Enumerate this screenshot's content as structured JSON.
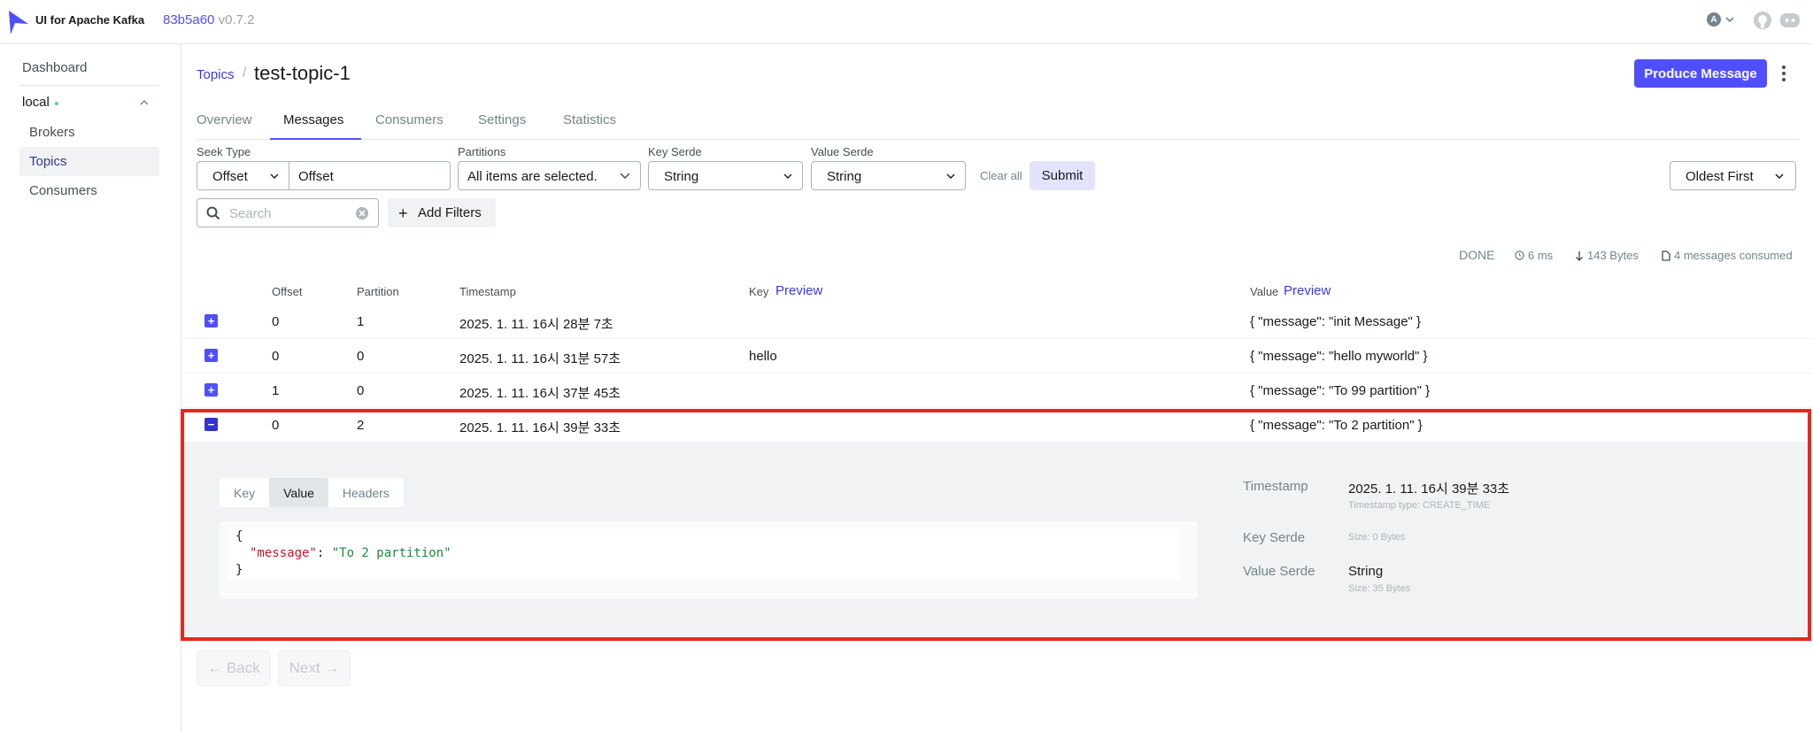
{
  "app": {
    "title": "UI for Apache Kafka",
    "version_hash": "83b5a60",
    "version": "v0.7.2",
    "user_initial": "A"
  },
  "sidebar": {
    "dashboard": "Dashboard",
    "cluster": "local",
    "items": [
      "Brokers",
      "Topics",
      "Consumers"
    ]
  },
  "breadcrumb": {
    "parent": "Topics",
    "sep": "/"
  },
  "topic_name": "test-topic-1",
  "produce_label": "Produce Message",
  "tabs": [
    "Overview",
    "Messages",
    "Consumers",
    "Settings",
    "Statistics"
  ],
  "filters": {
    "seek_type_label": "Seek Type",
    "seek_type": "Offset",
    "offset_placeholder": "Offset",
    "partitions_label": "Partitions",
    "partitions": "All items are selected.",
    "key_serde_label": "Key Serde",
    "key_serde": "String",
    "value_serde_label": "Value Serde",
    "value_serde": "String",
    "clear_all": "Clear all",
    "submit": "Submit",
    "sort": "Oldest First",
    "search_placeholder": "Search",
    "add_filters": "Add Filters"
  },
  "status": {
    "state": "DONE",
    "elapsed": "6 ms",
    "bytes": "143 Bytes",
    "consumed": "4 messages consumed"
  },
  "table": {
    "headers": {
      "offset": "Offset",
      "partition": "Partition",
      "timestamp": "Timestamp",
      "key": "Key",
      "value": "Value",
      "preview": "Preview"
    },
    "rows": [
      {
        "offset": "0",
        "partition": "1",
        "timestamp": "2025. 1. 11. 16시 28분 7초",
        "key": "",
        "value": "{ \"message\": \"init Message\" }"
      },
      {
        "offset": "0",
        "partition": "0",
        "timestamp": "2025. 1. 11. 16시 31분 57초",
        "key": "hello",
        "value": "{ \"message\": \"hello myworld\" }"
      },
      {
        "offset": "1",
        "partition": "0",
        "timestamp": "2025. 1. 11. 16시 37분 45초",
        "key": "",
        "value": "{ \"message\": \"To 99 partition\" }"
      },
      {
        "offset": "0",
        "partition": "2",
        "timestamp": "2025. 1. 11. 16시 39분 33초",
        "key": "",
        "value": "{ \"message\": \"To 2 partition\" }"
      }
    ]
  },
  "expanded": {
    "tabs": [
      "Key",
      "Value",
      "Headers"
    ],
    "code": {
      "open": "{",
      "key": "\"message\"",
      "colon": ": ",
      "value": "\"To 2 partition\"",
      "close": "}"
    },
    "timestamp_label": "Timestamp",
    "timestamp": "2025. 1. 11. 16시 39분 33초",
    "timestamp_type": "Timestamp type: CREATE_TIME",
    "key_serde_label": "Key Serde",
    "key_size": "Size: 0 Bytes",
    "value_serde_label": "Value Serde",
    "value_serde": "String",
    "value_size": "Size: 35 Bytes"
  },
  "pagination": {
    "back": "← Back",
    "next": "Next →"
  },
  "colors": {
    "accent": "#4f4fff",
    "highlight": "#e8281e"
  }
}
